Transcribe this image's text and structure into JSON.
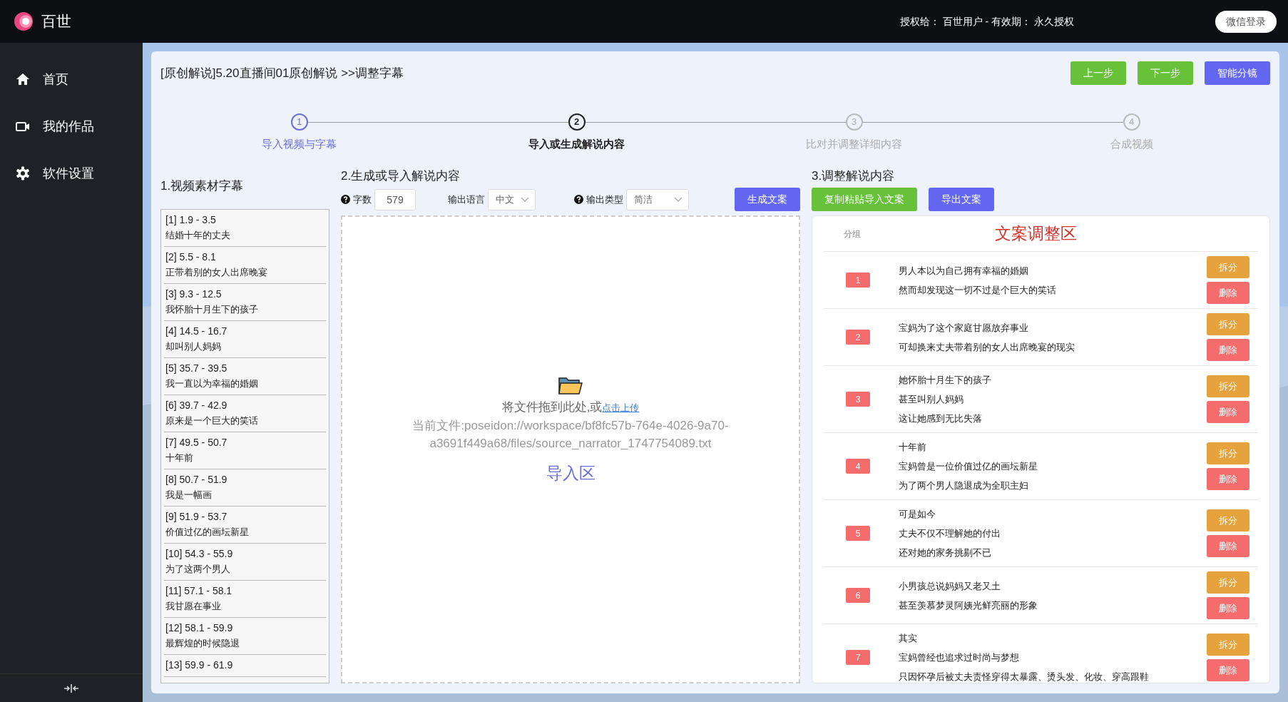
{
  "app": {
    "name": "百世",
    "license": "授权给： 百世用户 - 有效期： 永久授权",
    "login_button": "微信登录"
  },
  "sidebar": {
    "items": [
      {
        "label": "首页"
      },
      {
        "label": "我的作品"
      },
      {
        "label": "软件设置"
      }
    ]
  },
  "header": {
    "title": "[原创解说]5.20直播间01原创解说 >>调整字幕",
    "buttons": [
      {
        "label": "上一步",
        "kind": "success"
      },
      {
        "label": "下一步",
        "kind": "success"
      },
      {
        "label": "智能分镜",
        "kind": "primary"
      }
    ]
  },
  "steps": [
    {
      "number": "1",
      "label": "导入视频与字幕",
      "completed": true,
      "selected": false
    },
    {
      "number": "2",
      "label": "导入或生成解说内容",
      "completed": false,
      "selected": true
    },
    {
      "number": "3",
      "label": "比对并调整详细内容",
      "completed": false,
      "selected": false
    },
    {
      "number": "4",
      "label": "合成视频",
      "completed": false,
      "selected": false
    }
  ],
  "subtitles": {
    "title": "1.视频素材字幕",
    "items": [
      {
        "time": "[1] 1.9 - 3.5",
        "text": "结婚十年的丈夫"
      },
      {
        "time": "[2] 5.5 - 8.1",
        "text": "正带着别的女人出席晚宴"
      },
      {
        "time": "[3] 9.3 - 12.5",
        "text": "我怀胎十月生下的孩子"
      },
      {
        "time": "[4] 14.5 - 16.7",
        "text": "却叫别人妈妈"
      },
      {
        "time": "[5] 35.7 - 39.5",
        "text": "我一直以为幸福的婚姻"
      },
      {
        "time": "[6] 39.7 - 42.9",
        "text": "原来是一个巨大的笑话"
      },
      {
        "time": "[7] 49.5 - 50.7",
        "text": "十年前"
      },
      {
        "time": "[8] 50.7 - 51.9",
        "text": "我是一幅画"
      },
      {
        "time": "[9] 51.9 - 53.7",
        "text": "价值过亿的画坛新星"
      },
      {
        "time": "[10] 54.3 - 55.9",
        "text": "为了这两个男人"
      },
      {
        "time": "[11] 57.1 - 58.1",
        "text": "我甘愿在事业"
      },
      {
        "time": "[12] 58.1 - 59.9",
        "text": "最辉煌的时候隐退"
      },
      {
        "time": "[13] 59.9 - 61.9"
      }
    ]
  },
  "generate": {
    "title": "2.生成或导入解说内容",
    "word_count": {
      "label": "字数",
      "value": "579"
    },
    "language": {
      "label": "输出语言",
      "value": "中文"
    },
    "output_type": {
      "label": "输出类型",
      "value": "简洁"
    },
    "generate_button": "生成文案",
    "dropzone": {
      "prompt": "将文件拖到此处,或",
      "link": "点击上传",
      "current_file": "当前文件:poseidon://workspace/bf8fc57b-764e-4026-9a70-a3691f449a68/files/source_narrator_1747754089.txt",
      "area_label": "导入区"
    }
  },
  "adjust": {
    "title": "3.调整解说内容",
    "buttons": [
      {
        "label": "复制粘贴导入文案",
        "kind": "success"
      },
      {
        "label": "导出文案",
        "kind": "primary"
      }
    ],
    "group_header": "分组",
    "panel_title": "文案调整区",
    "groups": [
      {
        "number": "1",
        "lines": [
          "男人本以为自己拥有幸福的婚姻",
          "然而却发现这一切不过是个巨大的笑话"
        ],
        "split_button": "拆分",
        "delete_button": "删除"
      },
      {
        "number": "2",
        "lines": [
          "宝妈为了这个家庭甘愿放弃事业",
          "可却换来丈夫带着别的女人出席晚宴的现实"
        ],
        "split_button": "拆分",
        "delete_button": "删除"
      },
      {
        "number": "3",
        "lines": [
          "她怀胎十月生下的孩子",
          "甚至叫别人妈妈",
          "这让她感到无比失落"
        ],
        "split_button": "拆分",
        "delete_button": "删除"
      },
      {
        "number": "4",
        "lines": [
          "十年前",
          "宝妈曾是一位价值过亿的画坛新星",
          "为了两个男人隐退成为全职主妇"
        ],
        "split_button": "拆分",
        "delete_button": "删除"
      },
      {
        "number": "5",
        "lines": [
          "可是如今",
          "丈夫不仅不理解她的付出",
          "还对她的家务挑剔不已"
        ],
        "split_button": "拆分",
        "delete_button": "删除"
      },
      {
        "number": "6",
        "lines": [
          "小男孩总说妈妈又老又土",
          "甚至羡慕梦灵阿姨光鲜亮丽的形象"
        ],
        "split_button": "拆分",
        "delete_button": "删除"
      },
      {
        "number": "7",
        "lines": [
          "其实",
          "宝妈曾经也追求过时尚与梦想",
          "只因怀孕后被丈夫责怪穿得太暴露、烫头发、化妆、穿高跟鞋"
        ],
        "split_button": "拆分",
        "delete_button": "删除"
      }
    ]
  }
}
